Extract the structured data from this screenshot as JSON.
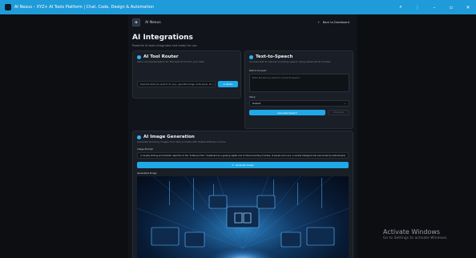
{
  "window": {
    "title": "AI Nexus – XYZ+ AI Tools Platform | Chat, Code, Design & Automation",
    "controls": [
      "search-icon",
      "more-icon",
      "minimize-icon",
      "maximize-icon",
      "close-icon"
    ],
    "control_glyphs": {
      "search": "⌕",
      "more": "⋮",
      "minimize": "–",
      "maximize": "▫",
      "close": "✕"
    }
  },
  "header": {
    "brand_name": "AI Nexus",
    "brand_logo_glyph": "◈",
    "back_link": "Back to Dashboard",
    "back_arrow": "←"
  },
  "page": {
    "title": "AI Integrations",
    "subtitle": "Powerful AI tools integrated and ready for use"
  },
  "router": {
    "title": "AI Tool Router",
    "subtitle": "Get a recommendation for the best AI tool for your task",
    "input_placeholder": "Describe what you want to do (e.g., generate image, write poem, etc.)",
    "button_label": "Route",
    "button_glyph": "➤"
  },
  "tts": {
    "title": "Text-to-Speech",
    "subtitle": "Convert text to natural sounding speech using advanced AI models",
    "text_label": "Text to Convert",
    "text_placeholder": "Enter the text you want to convert to speech...",
    "voice_label": "Voice",
    "voice_value": "Default",
    "generate_label": "Generate Speech",
    "download_label": "Download"
  },
  "image_gen": {
    "title": "AI Image Generation",
    "subtitle": "Generate stunning images from text prompts with Stable Diffusion & Flux",
    "prompt_label": "Image Prompt",
    "prompt_value": "A visually striking and futuristic depiction of the \"AI Nexus XYZ+\" dashboard as a glowing digital core of interconnecting modules, UI panels and icons. A central intelligent hub surrounded by data streams",
    "button_label": "Generate Image",
    "button_glyph": "⟳",
    "generated_label": "Generated Image"
  },
  "os_overlay": {
    "title": "Activate Windows",
    "subtitle": "Go to Settings to activate Windows."
  },
  "colors": {
    "accent": "#1fa9e8",
    "titlebar": "#1f9bd9",
    "background": "#0c0e12",
    "card": "#1a1e26"
  }
}
